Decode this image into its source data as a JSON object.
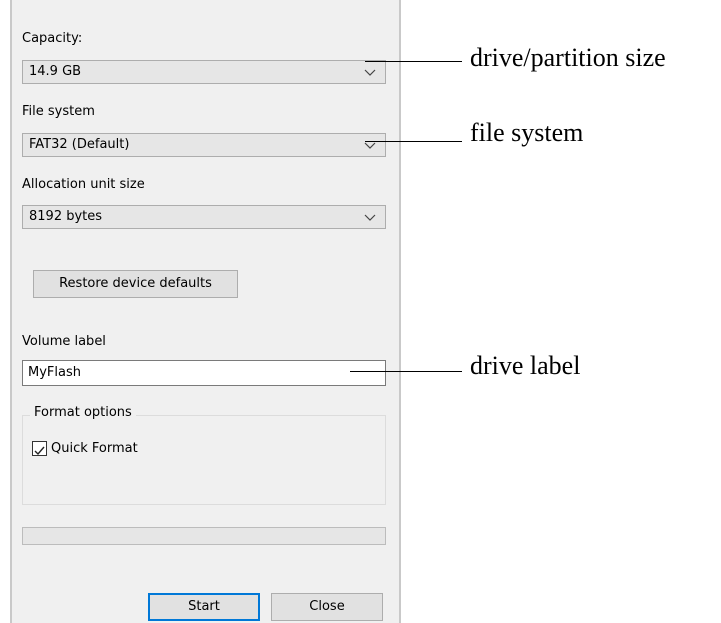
{
  "format_dialog": {
    "capacity_label": "Capacity:",
    "capacity_value": "14.9 GB",
    "filesystem_label": "File system",
    "filesystem_value": "FAT32 (Default)",
    "allocation_label": "Allocation unit size",
    "allocation_value": "8192 bytes",
    "restore_button": "Restore device defaults",
    "volume_label_label": "Volume label",
    "volume_label_value": "MyFlash",
    "format_options_title": "Format options",
    "quick_format_label": "Quick Format",
    "quick_format_checked": true,
    "progress": 0,
    "start_button": "Start",
    "close_button": "Close"
  },
  "annotations": {
    "capacity_note": "drive/partition size",
    "filesystem_note": "file system",
    "volume_note": "drive label"
  },
  "colors": {
    "dialog_background": "#f0f0f0",
    "primary_button_border": "#0078d7"
  }
}
